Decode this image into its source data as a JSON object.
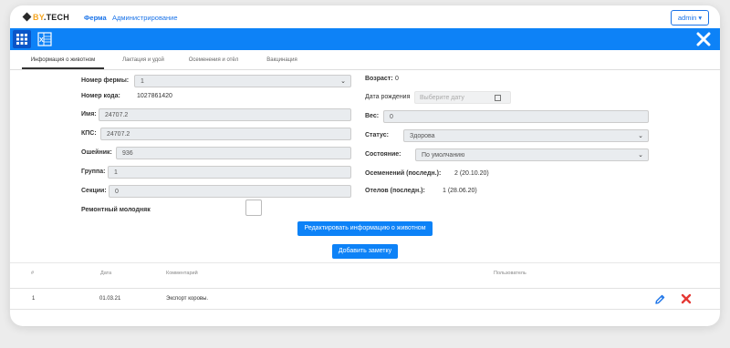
{
  "brand": {
    "prefix": "BY",
    "suffix": ".TECH"
  },
  "nav": {
    "farm": "Ферма",
    "admin": "Администрирование",
    "user": "admin ▾"
  },
  "toolbar": {
    "grid_icon": "grid-icon",
    "excel_icon": "excel-icon",
    "close_icon": "close-icon"
  },
  "tabs": [
    {
      "label": "Информация о животном",
      "active": true
    },
    {
      "label": "Лактация и удой",
      "active": false
    },
    {
      "label": "Осеменения и отёл",
      "active": false
    },
    {
      "label": "Вакцинация",
      "active": false
    }
  ],
  "form": {
    "farm_number": {
      "label": "Номер фермы:",
      "value": "1"
    },
    "code_number": {
      "label": "Номер кода:",
      "value": "1027861420"
    },
    "name": {
      "label": "Имя:",
      "value": "24707.2"
    },
    "kps": {
      "label": "КПС:",
      "value": "24707.2"
    },
    "collar": {
      "label": "Ошейник:",
      "value": "936"
    },
    "group": {
      "label": "Группа:",
      "value": "1"
    },
    "section": {
      "label": "Секции:",
      "value": "0"
    },
    "repair_young": {
      "label": "Ремонтный молодняк",
      "checked": false
    },
    "age": {
      "label": "Возраст:",
      "value": "0"
    },
    "birth_date": {
      "label": "Дата рождения",
      "placeholder": "Выберите дату"
    },
    "weight": {
      "label": "Вес:",
      "value": "0"
    },
    "status": {
      "label": "Статус:",
      "value": "Здорова"
    },
    "condition": {
      "label": "Состояние:",
      "value": "По умолчанию"
    },
    "last_insemination": {
      "label": "Осеменений (последн.):",
      "value": "2 (20.10.20)"
    },
    "last_calving": {
      "label": "Отелов (последн.):",
      "value": "1 (28.06.20)"
    }
  },
  "buttons": {
    "edit_info": "Редактировать информацию о животном",
    "add_note": "Добавить заметку"
  },
  "table": {
    "headers": [
      "#",
      "Дата",
      "Комментарий",
      "Пользователь"
    ],
    "rows": [
      {
        "num": "1",
        "date": "01.03.21",
        "comment": "Экспорт коровы.",
        "user": ""
      }
    ]
  },
  "colors": {
    "primary": "#0d82f7",
    "danger": "#e53935",
    "brand_accent": "#f5a623"
  }
}
